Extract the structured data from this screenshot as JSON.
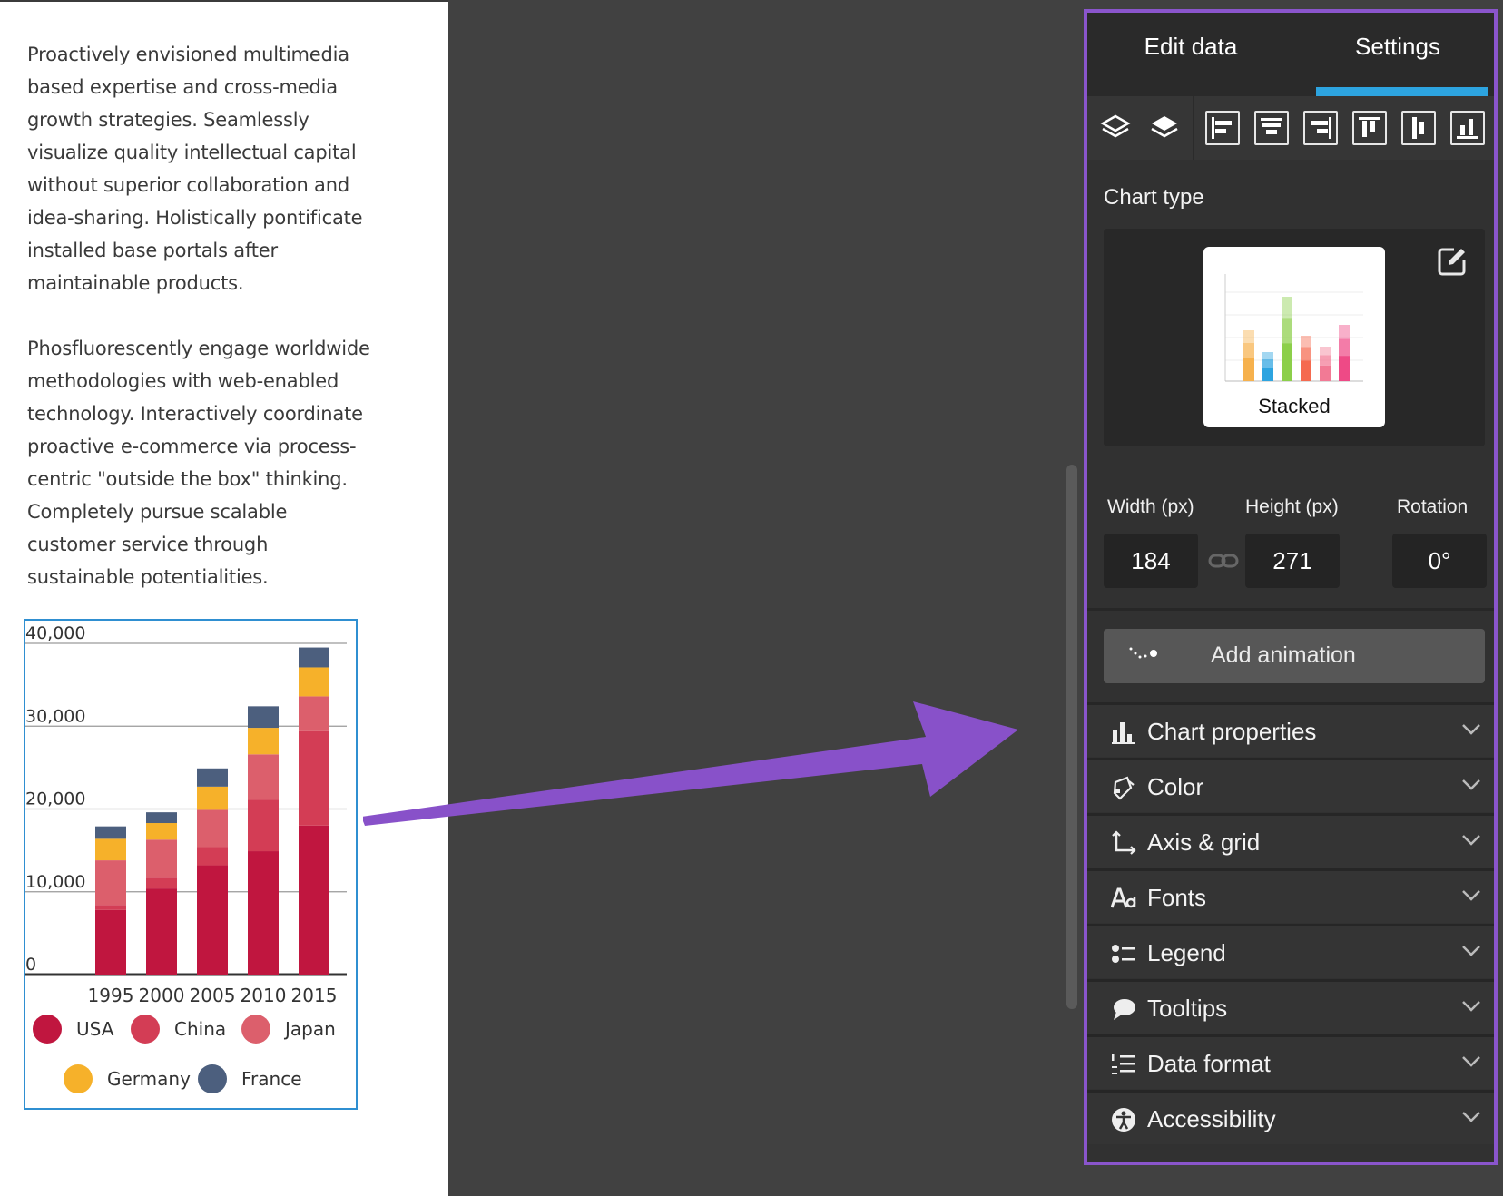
{
  "document": {
    "paragraph1": "Proactively envisioned multimedia based expertise and cross-media growth strategies. Seamlessly visualize quality intellectual capital without superior collaboration and idea-sharing. Holistically pontificate installed base portals after maintainable products.",
    "paragraph2": "Phosfluorescently engage worldwide methodologies with web-enabled technology. Interactively coordinate proactive e-commerce via process-centric \"outside the box\" thinking. Completely pursue scalable customer service through sustainable potentialities."
  },
  "chart_data": {
    "type": "bar",
    "stacked": true,
    "categories": [
      "1995",
      "2000",
      "2005",
      "2010",
      "2015"
    ],
    "ylim": [
      0,
      40000
    ],
    "yticks": [
      "40,000",
      "30,000",
      "20,000",
      "10,000",
      "0"
    ],
    "grid": true,
    "legend_position": "bottom",
    "series": [
      {
        "name": "USA",
        "color": "#c0163f",
        "values": [
          7800,
          10400,
          13200,
          14900,
          18000
        ]
      },
      {
        "name": "China",
        "color": "#d33d55",
        "values": [
          600,
          1300,
          2200,
          6200,
          11400
        ]
      },
      {
        "name": "Japan",
        "color": "#dc5f6c",
        "values": [
          5400,
          4600,
          4500,
          5500,
          4200
        ]
      },
      {
        "name": "Germany",
        "color": "#f6b12a",
        "values": [
          2600,
          2000,
          2800,
          3200,
          3500
        ]
      },
      {
        "name": "France",
        "color": "#4c5f7e",
        "values": [
          1500,
          1300,
          2200,
          2600,
          2400
        ]
      }
    ]
  },
  "panel": {
    "tabs": [
      {
        "label": "Edit data"
      },
      {
        "label": "Settings"
      }
    ],
    "chart_type": {
      "label": "Chart type",
      "selected": "Stacked",
      "preview_colors": [
        "#f6b14d",
        "#2da4e0",
        "#8ccf4a",
        "#f56a4f",
        "#f27a95",
        "#ee4a86"
      ]
    },
    "dimensions": {
      "width_label": "Width (px)",
      "height_label": "Height (px)",
      "rotation_label": "Rotation",
      "width": "184",
      "height": "271",
      "rotation": "0°"
    },
    "add_animation": "Add animation",
    "sections": [
      {
        "label": "Chart properties",
        "icon": "bar-chart-icon"
      },
      {
        "label": "Color",
        "icon": "paint-bucket-icon"
      },
      {
        "label": "Axis & grid",
        "icon": "axis-icon"
      },
      {
        "label": "Fonts",
        "icon": "font-icon"
      },
      {
        "label": "Legend",
        "icon": "legend-icon"
      },
      {
        "label": "Tooltips",
        "icon": "speech-bubble-icon"
      },
      {
        "label": "Data format",
        "icon": "numbered-list-icon"
      },
      {
        "label": "Accessibility",
        "icon": "accessibility-icon"
      }
    ]
  }
}
